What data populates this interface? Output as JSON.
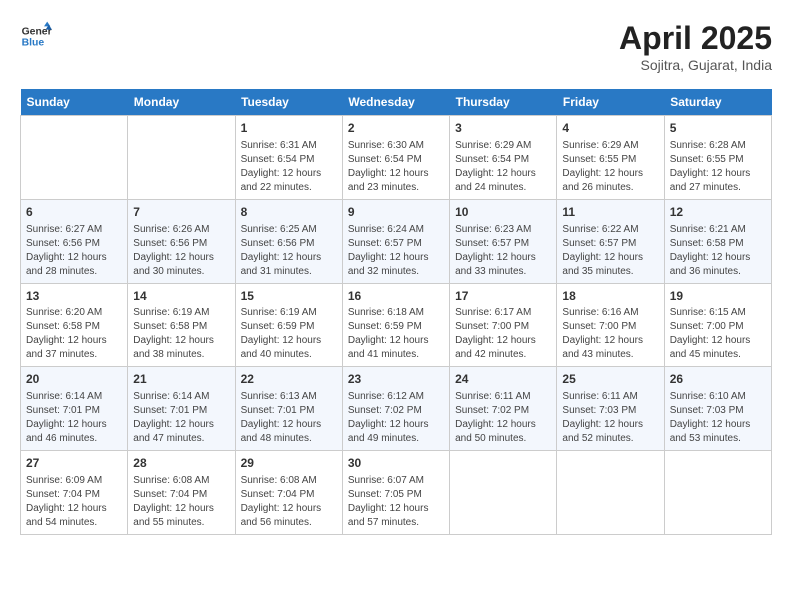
{
  "header": {
    "logo_general": "General",
    "logo_blue": "Blue",
    "title": "April 2025",
    "subtitle": "Sojitra, Gujarat, India"
  },
  "columns": [
    "Sunday",
    "Monday",
    "Tuesday",
    "Wednesday",
    "Thursday",
    "Friday",
    "Saturday"
  ],
  "rows": [
    [
      {
        "day": "",
        "sunrise": "",
        "sunset": "",
        "daylight": ""
      },
      {
        "day": "",
        "sunrise": "",
        "sunset": "",
        "daylight": ""
      },
      {
        "day": "1",
        "sunrise": "Sunrise: 6:31 AM",
        "sunset": "Sunset: 6:54 PM",
        "daylight": "Daylight: 12 hours and 22 minutes."
      },
      {
        "day": "2",
        "sunrise": "Sunrise: 6:30 AM",
        "sunset": "Sunset: 6:54 PM",
        "daylight": "Daylight: 12 hours and 23 minutes."
      },
      {
        "day": "3",
        "sunrise": "Sunrise: 6:29 AM",
        "sunset": "Sunset: 6:54 PM",
        "daylight": "Daylight: 12 hours and 24 minutes."
      },
      {
        "day": "4",
        "sunrise": "Sunrise: 6:29 AM",
        "sunset": "Sunset: 6:55 PM",
        "daylight": "Daylight: 12 hours and 26 minutes."
      },
      {
        "day": "5",
        "sunrise": "Sunrise: 6:28 AM",
        "sunset": "Sunset: 6:55 PM",
        "daylight": "Daylight: 12 hours and 27 minutes."
      }
    ],
    [
      {
        "day": "6",
        "sunrise": "Sunrise: 6:27 AM",
        "sunset": "Sunset: 6:56 PM",
        "daylight": "Daylight: 12 hours and 28 minutes."
      },
      {
        "day": "7",
        "sunrise": "Sunrise: 6:26 AM",
        "sunset": "Sunset: 6:56 PM",
        "daylight": "Daylight: 12 hours and 30 minutes."
      },
      {
        "day": "8",
        "sunrise": "Sunrise: 6:25 AM",
        "sunset": "Sunset: 6:56 PM",
        "daylight": "Daylight: 12 hours and 31 minutes."
      },
      {
        "day": "9",
        "sunrise": "Sunrise: 6:24 AM",
        "sunset": "Sunset: 6:57 PM",
        "daylight": "Daylight: 12 hours and 32 minutes."
      },
      {
        "day": "10",
        "sunrise": "Sunrise: 6:23 AM",
        "sunset": "Sunset: 6:57 PM",
        "daylight": "Daylight: 12 hours and 33 minutes."
      },
      {
        "day": "11",
        "sunrise": "Sunrise: 6:22 AM",
        "sunset": "Sunset: 6:57 PM",
        "daylight": "Daylight: 12 hours and 35 minutes."
      },
      {
        "day": "12",
        "sunrise": "Sunrise: 6:21 AM",
        "sunset": "Sunset: 6:58 PM",
        "daylight": "Daylight: 12 hours and 36 minutes."
      }
    ],
    [
      {
        "day": "13",
        "sunrise": "Sunrise: 6:20 AM",
        "sunset": "Sunset: 6:58 PM",
        "daylight": "Daylight: 12 hours and 37 minutes."
      },
      {
        "day": "14",
        "sunrise": "Sunrise: 6:19 AM",
        "sunset": "Sunset: 6:58 PM",
        "daylight": "Daylight: 12 hours and 38 minutes."
      },
      {
        "day": "15",
        "sunrise": "Sunrise: 6:19 AM",
        "sunset": "Sunset: 6:59 PM",
        "daylight": "Daylight: 12 hours and 40 minutes."
      },
      {
        "day": "16",
        "sunrise": "Sunrise: 6:18 AM",
        "sunset": "Sunset: 6:59 PM",
        "daylight": "Daylight: 12 hours and 41 minutes."
      },
      {
        "day": "17",
        "sunrise": "Sunrise: 6:17 AM",
        "sunset": "Sunset: 7:00 PM",
        "daylight": "Daylight: 12 hours and 42 minutes."
      },
      {
        "day": "18",
        "sunrise": "Sunrise: 6:16 AM",
        "sunset": "Sunset: 7:00 PM",
        "daylight": "Daylight: 12 hours and 43 minutes."
      },
      {
        "day": "19",
        "sunrise": "Sunrise: 6:15 AM",
        "sunset": "Sunset: 7:00 PM",
        "daylight": "Daylight: 12 hours and 45 minutes."
      }
    ],
    [
      {
        "day": "20",
        "sunrise": "Sunrise: 6:14 AM",
        "sunset": "Sunset: 7:01 PM",
        "daylight": "Daylight: 12 hours and 46 minutes."
      },
      {
        "day": "21",
        "sunrise": "Sunrise: 6:14 AM",
        "sunset": "Sunset: 7:01 PM",
        "daylight": "Daylight: 12 hours and 47 minutes."
      },
      {
        "day": "22",
        "sunrise": "Sunrise: 6:13 AM",
        "sunset": "Sunset: 7:01 PM",
        "daylight": "Daylight: 12 hours and 48 minutes."
      },
      {
        "day": "23",
        "sunrise": "Sunrise: 6:12 AM",
        "sunset": "Sunset: 7:02 PM",
        "daylight": "Daylight: 12 hours and 49 minutes."
      },
      {
        "day": "24",
        "sunrise": "Sunrise: 6:11 AM",
        "sunset": "Sunset: 7:02 PM",
        "daylight": "Daylight: 12 hours and 50 minutes."
      },
      {
        "day": "25",
        "sunrise": "Sunrise: 6:11 AM",
        "sunset": "Sunset: 7:03 PM",
        "daylight": "Daylight: 12 hours and 52 minutes."
      },
      {
        "day": "26",
        "sunrise": "Sunrise: 6:10 AM",
        "sunset": "Sunset: 7:03 PM",
        "daylight": "Daylight: 12 hours and 53 minutes."
      }
    ],
    [
      {
        "day": "27",
        "sunrise": "Sunrise: 6:09 AM",
        "sunset": "Sunset: 7:04 PM",
        "daylight": "Daylight: 12 hours and 54 minutes."
      },
      {
        "day": "28",
        "sunrise": "Sunrise: 6:08 AM",
        "sunset": "Sunset: 7:04 PM",
        "daylight": "Daylight: 12 hours and 55 minutes."
      },
      {
        "day": "29",
        "sunrise": "Sunrise: 6:08 AM",
        "sunset": "Sunset: 7:04 PM",
        "daylight": "Daylight: 12 hours and 56 minutes."
      },
      {
        "day": "30",
        "sunrise": "Sunrise: 6:07 AM",
        "sunset": "Sunset: 7:05 PM",
        "daylight": "Daylight: 12 hours and 57 minutes."
      },
      {
        "day": "",
        "sunrise": "",
        "sunset": "",
        "daylight": ""
      },
      {
        "day": "",
        "sunrise": "",
        "sunset": "",
        "daylight": ""
      },
      {
        "day": "",
        "sunrise": "",
        "sunset": "",
        "daylight": ""
      }
    ]
  ]
}
